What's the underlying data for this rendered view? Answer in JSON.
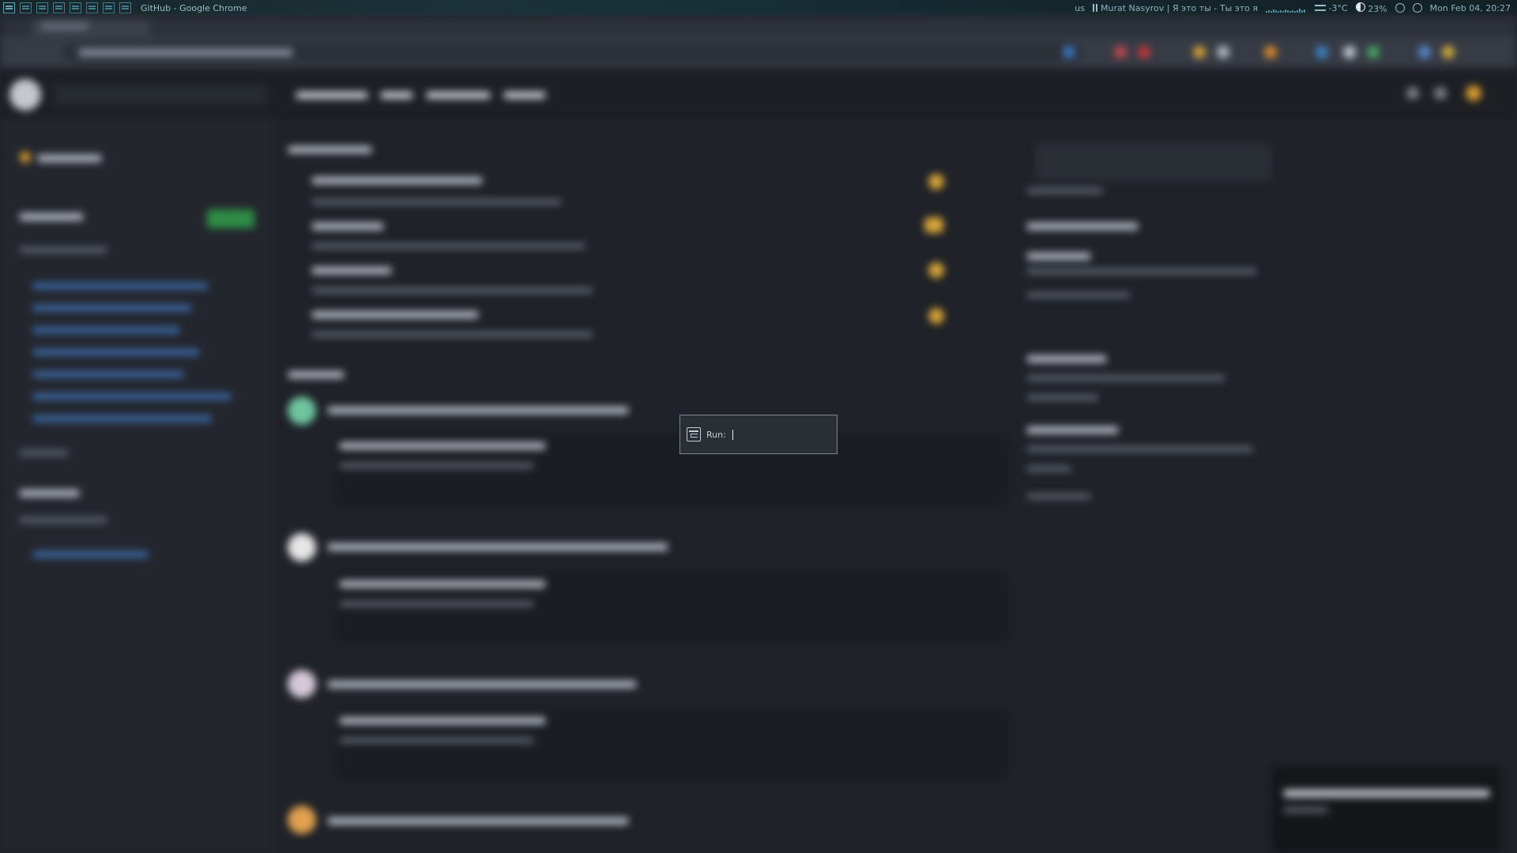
{
  "topbar": {
    "window_title": "GitHub - Google Chrome",
    "keyboard_layout": "us",
    "now_playing": "Murat Nasyrov | Я это ты - Ты это я",
    "temperature": "-3°C",
    "brightness": "23%",
    "datetime": "Mon Feb 04, 20:27"
  },
  "run_prompt": {
    "label": "Run:",
    "value": ""
  }
}
